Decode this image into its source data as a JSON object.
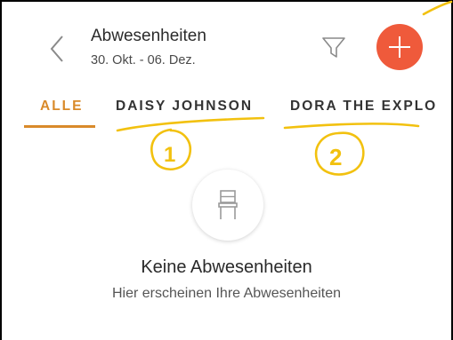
{
  "header": {
    "title": "Abwesenheiten",
    "subtitle": "30. Okt. - 06. Dez."
  },
  "tabs": [
    {
      "label": "ALLE",
      "active": true
    },
    {
      "label": "DAISY JOHNSON",
      "active": false
    },
    {
      "label": "DORA THE EXPLO",
      "active": false
    }
  ],
  "empty_state": {
    "icon": "chair-icon",
    "title": "Keine Abwesenheiten",
    "subtitle": "Hier erscheinen Ihre Abwesenheiten"
  },
  "annotations": {
    "marks": [
      "1",
      "2"
    ],
    "color": "#f2c10f"
  },
  "colors": {
    "accent": "#d98a2a",
    "add_button": "#ef5a3b"
  }
}
